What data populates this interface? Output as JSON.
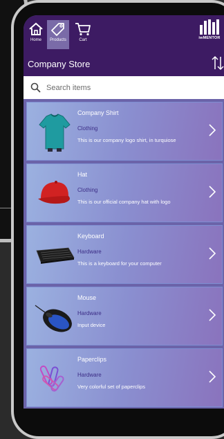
{
  "nav": {
    "items": [
      {
        "label": "Home",
        "icon": "home-icon"
      },
      {
        "label": "Products",
        "icon": "tag-icon",
        "active": true
      },
      {
        "label": "Cart",
        "icon": "cart-icon"
      }
    ],
    "logo_text": "iwMENTOR"
  },
  "header": {
    "title": "Company Store"
  },
  "search": {
    "placeholder": "Search items"
  },
  "products": [
    {
      "name": "Company Shirt",
      "category": "Clothing",
      "description": "This is our company logo shirt, in turquiose",
      "image": "shirt"
    },
    {
      "name": "Hat",
      "category": "Clothing",
      "description": "This is our official company hat with logo",
      "image": "cap"
    },
    {
      "name": "Keyboard",
      "category": "Hardware",
      "description": "This is a keyboard for your computer",
      "image": "keyboard"
    },
    {
      "name": "Mouse",
      "category": "Hardware",
      "description": "Input device",
      "image": "mouse"
    },
    {
      "name": "Paperclips",
      "category": "Hardware",
      "description": "Very colorful set of paperclips",
      "image": "paperclips"
    }
  ],
  "colors": {
    "header": "#3d1b63",
    "active_tab": "#7a6ba8",
    "category_text": "#3b2c86"
  }
}
